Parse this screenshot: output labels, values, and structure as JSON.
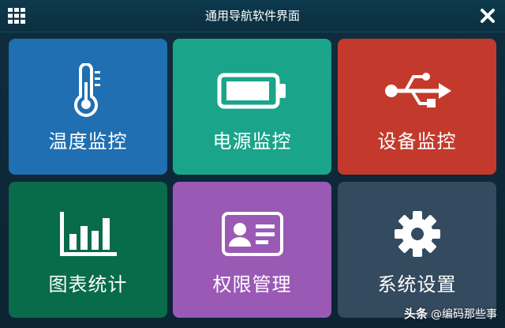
{
  "window": {
    "title": "通用导航软件界面"
  },
  "colors": {
    "background": "#0e2a3a",
    "tile_temperature": "#1f6fb2",
    "tile_power": "#1aa58a",
    "tile_device": "#c33a2c",
    "tile_stats": "#086b4a",
    "tile_permission": "#9b59b6",
    "tile_settings": "#344a5e"
  },
  "tiles": [
    {
      "label": "温度监控",
      "icon": "thermometer-icon"
    },
    {
      "label": "电源监控",
      "icon": "battery-icon"
    },
    {
      "label": "设备监控",
      "icon": "usb-icon"
    },
    {
      "label": "图表统计",
      "icon": "bar-chart-icon"
    },
    {
      "label": "权限管理",
      "icon": "id-card-icon"
    },
    {
      "label": "系统设置",
      "icon": "gear-icon"
    }
  ],
  "watermark": {
    "brand": "头条",
    "handle": "@编码那些事"
  }
}
